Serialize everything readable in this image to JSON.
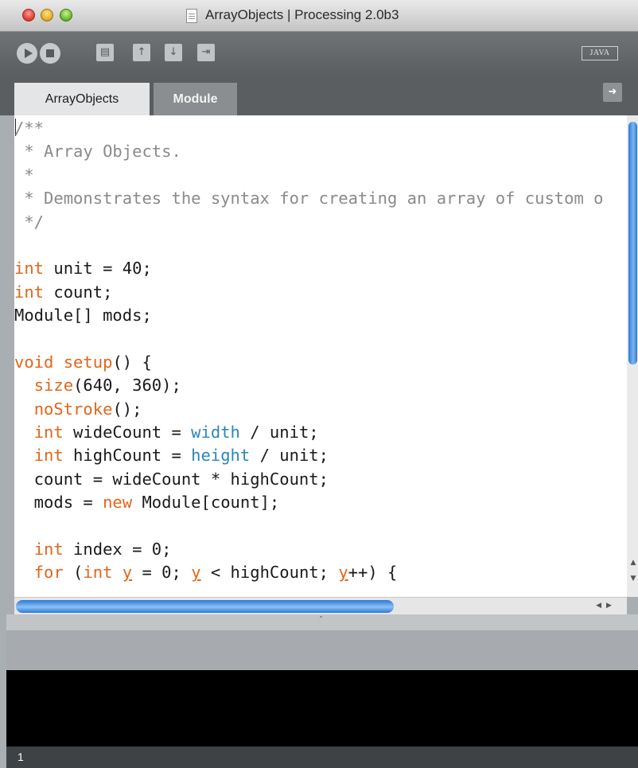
{
  "window": {
    "title": "ArrayObjects | Processing 2.0b3"
  },
  "toolbar": {
    "run_icon": "play-icon",
    "stop_icon": "stop-icon",
    "new_icon": "new-sketch-icon",
    "open_icon": "open-icon",
    "save_icon": "save-icon",
    "export_icon": "export-icon",
    "mode": "JAVA"
  },
  "tabs": [
    {
      "label": "ArrayObjects",
      "active": true
    },
    {
      "label": "Module",
      "active": false
    }
  ],
  "tab_menu_icon": "arrow-right-icon",
  "editor": {
    "lines": [
      {
        "parts": [
          {
            "t": "/**",
            "c": "comment"
          }
        ]
      },
      {
        "parts": [
          {
            "t": " * Array Objects.",
            "c": "comment"
          }
        ]
      },
      {
        "parts": [
          {
            "t": " *",
            "c": "comment"
          }
        ]
      },
      {
        "parts": [
          {
            "t": " * Demonstrates the syntax for creating an array of custom o",
            "c": "comment"
          }
        ]
      },
      {
        "parts": [
          {
            "t": " */",
            "c": "comment"
          }
        ]
      },
      {
        "parts": [
          {
            "t": "",
            "c": ""
          }
        ]
      },
      {
        "parts": [
          {
            "t": "int",
            "c": "kw"
          },
          {
            "t": " unit = 40;",
            "c": ""
          }
        ]
      },
      {
        "parts": [
          {
            "t": "int",
            "c": "kw"
          },
          {
            "t": " count;",
            "c": ""
          }
        ]
      },
      {
        "parts": [
          {
            "t": "Module[] mods;",
            "c": ""
          }
        ]
      },
      {
        "parts": [
          {
            "t": "",
            "c": ""
          }
        ]
      },
      {
        "parts": [
          {
            "t": "void",
            "c": "kw"
          },
          {
            "t": " ",
            "c": ""
          },
          {
            "t": "setup",
            "c": "fn"
          },
          {
            "t": "() {",
            "c": ""
          }
        ]
      },
      {
        "parts": [
          {
            "t": "  ",
            "c": ""
          },
          {
            "t": "size",
            "c": "fn"
          },
          {
            "t": "(640, 360);",
            "c": ""
          }
        ]
      },
      {
        "parts": [
          {
            "t": "  ",
            "c": ""
          },
          {
            "t": "noStroke",
            "c": "fn"
          },
          {
            "t": "();",
            "c": ""
          }
        ]
      },
      {
        "parts": [
          {
            "t": "  ",
            "c": ""
          },
          {
            "t": "int",
            "c": "kw"
          },
          {
            "t": " wideCount = ",
            "c": ""
          },
          {
            "t": "width",
            "c": "var"
          },
          {
            "t": " / unit;",
            "c": ""
          }
        ]
      },
      {
        "parts": [
          {
            "t": "  ",
            "c": ""
          },
          {
            "t": "int",
            "c": "kw"
          },
          {
            "t": " highCount = ",
            "c": ""
          },
          {
            "t": "height",
            "c": "var"
          },
          {
            "t": " / unit;",
            "c": ""
          }
        ]
      },
      {
        "parts": [
          {
            "t": "  count = wideCount * highCount;",
            "c": ""
          }
        ]
      },
      {
        "parts": [
          {
            "t": "  mods = ",
            "c": ""
          },
          {
            "t": "new",
            "c": "kw"
          },
          {
            "t": " Module[count];",
            "c": ""
          }
        ]
      },
      {
        "parts": [
          {
            "t": "",
            "c": ""
          }
        ]
      },
      {
        "parts": [
          {
            "t": "  ",
            "c": ""
          },
          {
            "t": "int",
            "c": "kw"
          },
          {
            "t": " index = 0;",
            "c": ""
          }
        ]
      },
      {
        "parts": [
          {
            "t": "  ",
            "c": ""
          },
          {
            "t": "for",
            "c": "kw"
          },
          {
            "t": " (",
            "c": ""
          },
          {
            "t": "int",
            "c": "kw"
          },
          {
            "t": " ",
            "c": ""
          },
          {
            "t": "y",
            "c": "kw under"
          },
          {
            "t": " = 0; ",
            "c": ""
          },
          {
            "t": "y",
            "c": "kw under"
          },
          {
            "t": " < highCount; ",
            "c": ""
          },
          {
            "t": "y",
            "c": "kw under"
          },
          {
            "t": "++) {",
            "c": ""
          }
        ]
      }
    ]
  },
  "status": {
    "line_number": "1"
  }
}
